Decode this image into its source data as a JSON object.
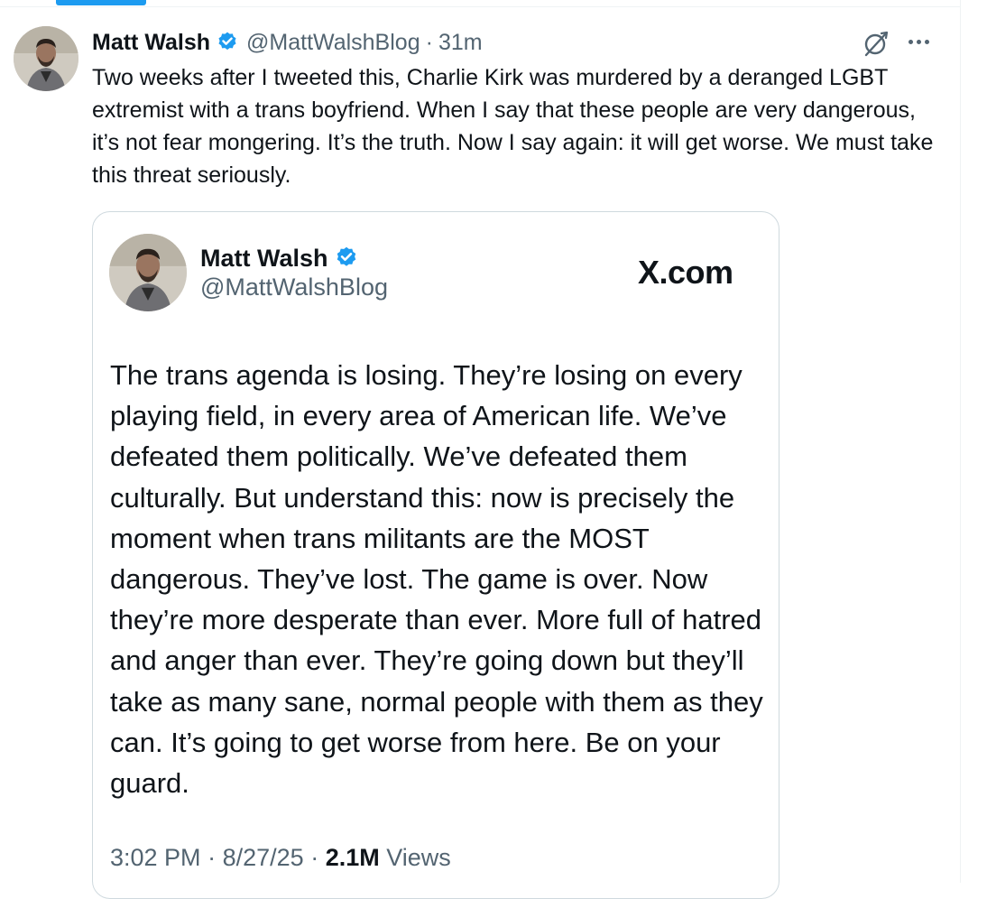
{
  "post": {
    "author_name": "Matt Walsh",
    "handle": "@MattWalshBlog",
    "separator": "·",
    "time": "31m",
    "text": "Two weeks after I tweeted this, Charlie Kirk was murdered by a deranged LGBT extremist with a trans boyfriend. When I say that these people are very dangerous, it’s not fear mongering. It’s the truth. Now I say again: it will get worse. We must take this threat seriously.",
    "icons": {
      "verified": "verified-badge-icon",
      "grok": "grok-icon",
      "more": "more-icon"
    }
  },
  "quote": {
    "author_name": "Matt Walsh",
    "handle": "@MattWalshBlog",
    "brand": "X.com",
    "text": "The trans agenda is losing. They’re losing on every playing field, in every area of American life. We’ve defeated them politically. We’ve defeated them culturally. But understand this: now is precisely the moment when trans militants are the MOST dangerous. They’ve lost. The game is over. Now they’re more desperate than ever. More full of hatred and anger than ever. They’re going down but they’ll take as many sane, normal people with them as they can. It’s going to get worse from here. Be on your guard.",
    "time": "3:02 PM",
    "date": "8/27/25",
    "separator": "·",
    "views_count": "2.1M",
    "views_label": "Views"
  },
  "colors": {
    "accent": "#1d9bf0",
    "text_primary": "#0f1419",
    "text_secondary": "#536471",
    "border": "#cfd9de"
  }
}
